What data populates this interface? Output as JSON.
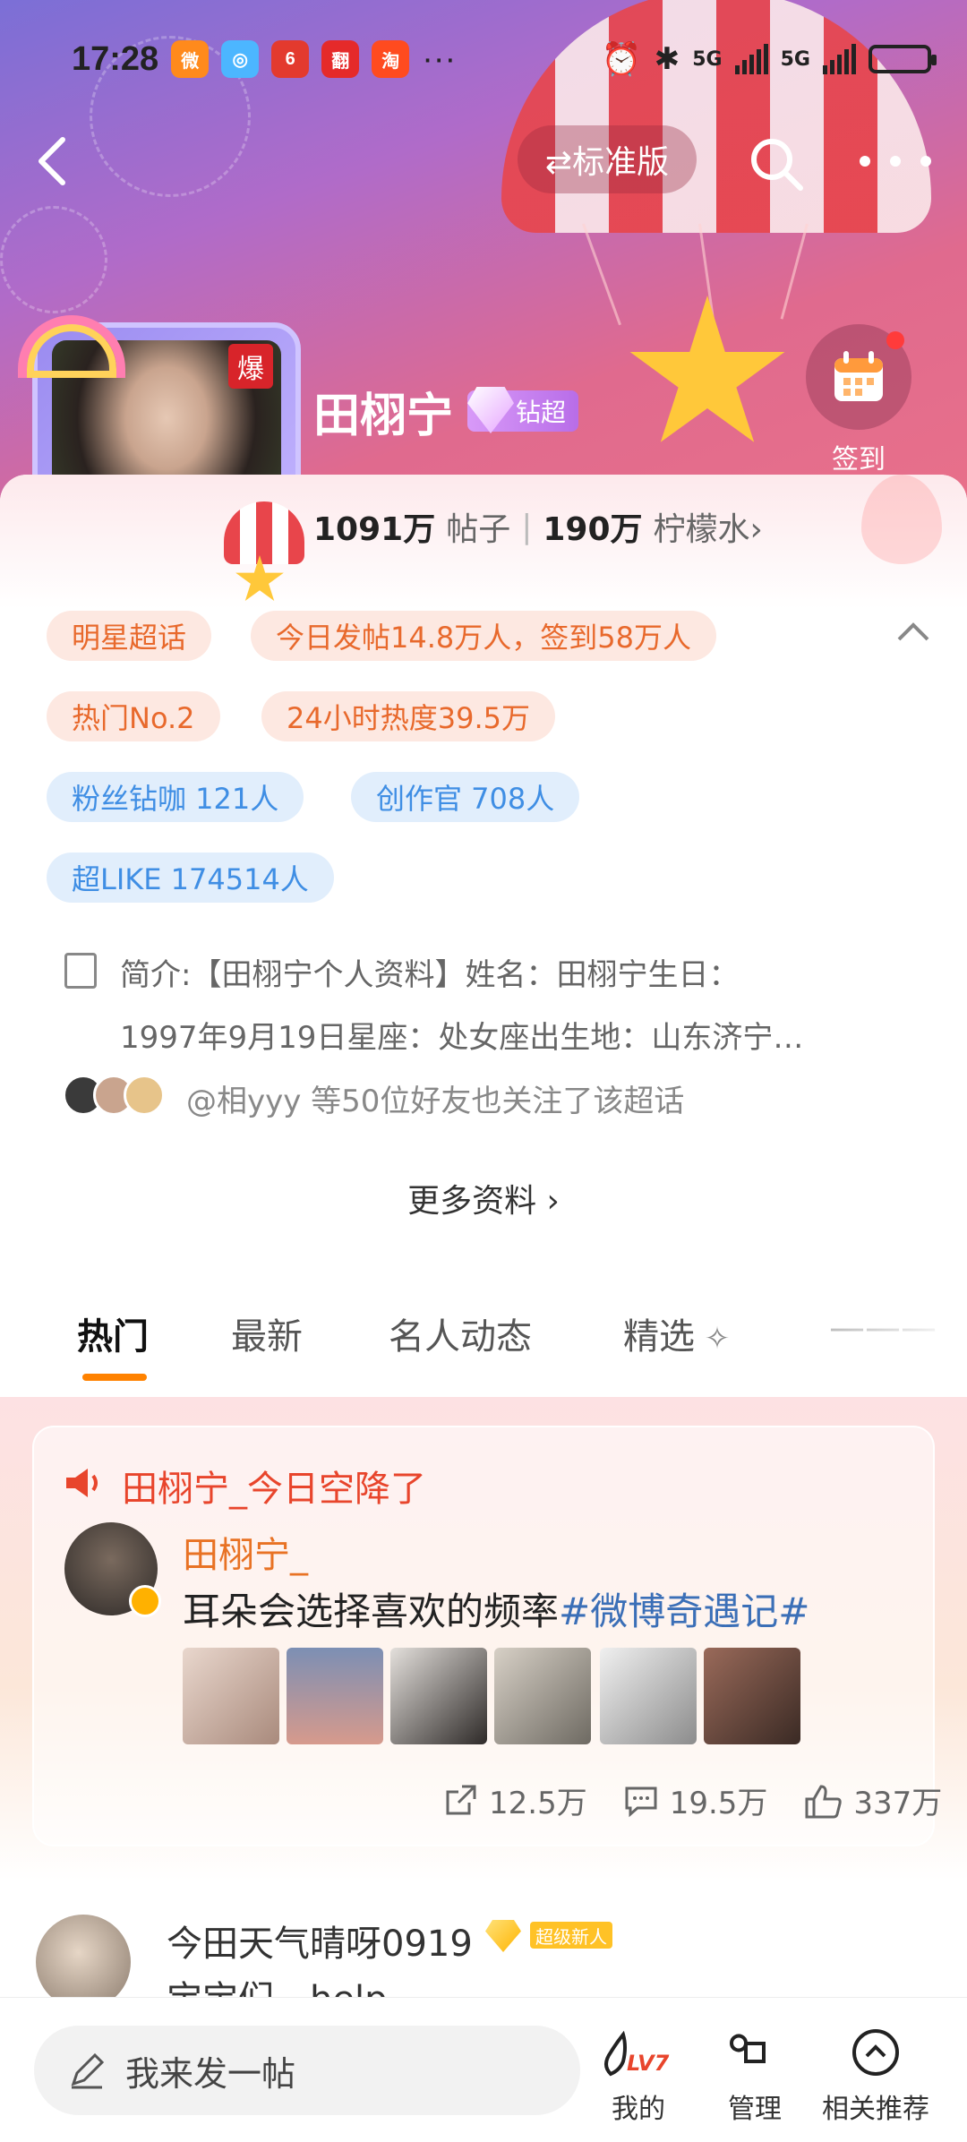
{
  "status_bar": {
    "time": "17:28",
    "app_icons": [
      "weibo-icon",
      "messages-icon",
      "618-icon",
      "taobao-fan-icon",
      "taobao-icon"
    ],
    "more": "···",
    "network_1": "5G",
    "network_2": "5G"
  },
  "header": {
    "mode_label": "⇄标准版"
  },
  "topic": {
    "name": "田栩宁",
    "hot_badge": "爆",
    "level_badge": "钻超",
    "checkin_label": "签到",
    "posts_count": "1091万",
    "posts_label": "帖子",
    "lemon_count": "190万",
    "lemon_label": "柠檬水›"
  },
  "tags": [
    {
      "label": "明星超话",
      "style": "orange"
    },
    {
      "label": "今日发帖14.8万人，签到58万人",
      "style": "orange"
    },
    {
      "label": "热门No.2",
      "style": "orange"
    },
    {
      "label": "24小时热度39.5万",
      "style": "orange"
    },
    {
      "label": "粉丝钻咖 121人",
      "style": "blue"
    },
    {
      "label": "创作官 708人",
      "style": "blue"
    },
    {
      "label": "超LIKE 174514人",
      "style": "blue"
    }
  ],
  "intro": {
    "line1": "简介:【田栩宁个人资料】姓名：田栩宁生日：",
    "line2": "1997年9月19日星座：处女座出生地：山东济宁…"
  },
  "friends_text": "@相yyy 等50位好友也关注了该超话",
  "more_info": "更多资料 ›",
  "tabs": [
    {
      "label": "热门",
      "active": true
    },
    {
      "label": "最新",
      "active": false
    },
    {
      "label": "名人动态",
      "active": false
    },
    {
      "label": "精选",
      "active": false
    }
  ],
  "featured": {
    "banner": "田栩宁_今日空降了",
    "author": "田栩宁_",
    "text": "耳朵会选择喜欢的频率",
    "hashtag": "#微博奇遇记#",
    "reposts": "12.5万",
    "comments": "19.5万",
    "likes": "337万"
  },
  "next_post": {
    "user": "今田天气晴呀0919",
    "badge": "超级新人",
    "text": "宝宝们，help"
  },
  "bottom": {
    "composer_placeholder": "我来发一帖",
    "nav": [
      {
        "label": "我的",
        "icon": "lv7-icon"
      },
      {
        "label": "管理",
        "icon": "command-icon"
      },
      {
        "label": "相关推荐",
        "icon": "chevron-up-circle-icon"
      }
    ],
    "level": "LV7"
  },
  "colors": {
    "accent_orange": "#ff8200",
    "tag_orange": "#e8692c",
    "tag_blue": "#3f8ee4",
    "hashtag": "#3b6fb7"
  }
}
